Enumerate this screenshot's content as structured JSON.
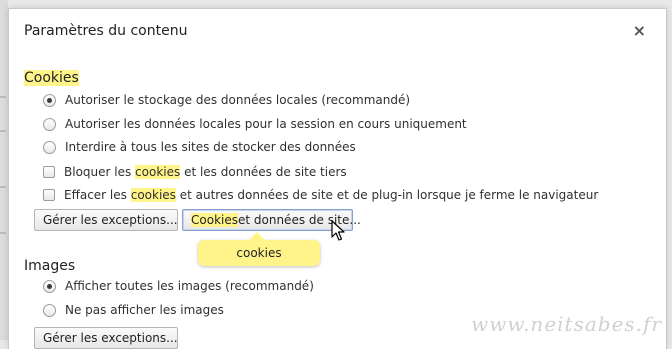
{
  "dialog": {
    "title": "Paramètres du contenu",
    "close_glyph": "×"
  },
  "cookies": {
    "heading": "Cookies",
    "radios": [
      {
        "label": "Autoriser le stockage des données locales (recommandé)",
        "checked": true
      },
      {
        "label": "Autoriser les données locales pour la session en cours uniquement",
        "checked": false
      },
      {
        "label": "Interdire à tous les sites de stocker des données",
        "checked": false
      }
    ],
    "checkbox_block": {
      "before": "Bloquer les ",
      "highlight": "cookies",
      "after": " et les données de site tiers",
      "checked": false
    },
    "checkbox_clear": {
      "before": "Effacer les ",
      "highlight": "cookies",
      "after": " et autres données de site et de plug-in lorsque je ferme le navigateur",
      "checked": false
    },
    "manage_exceptions_button": "Gérer les exceptions...",
    "cookies_data_button": {
      "highlight": "Cookies",
      "rest": " et données de site..."
    }
  },
  "tooltip": {
    "text": "cookies",
    "color": "#fff48a"
  },
  "images": {
    "heading": "Images",
    "radios": [
      {
        "label": "Afficher toutes les images (recommandé)",
        "checked": true
      },
      {
        "label": "Ne pas afficher les images",
        "checked": false
      }
    ],
    "manage_exceptions_button": "Gérer les exceptions..."
  },
  "watermark": "www.neitsabes.fr",
  "colors": {
    "highlight": "#fff48a",
    "focus_border": "#8aa2c9"
  }
}
